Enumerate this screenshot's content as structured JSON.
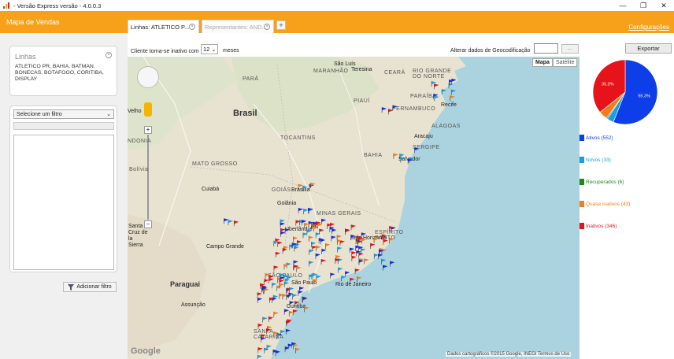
{
  "window": {
    "title": " - Versão Express  versão - 4.0.0.3",
    "minimize": "—",
    "restore": "❐",
    "close": "✕"
  },
  "header": {
    "app_name": "Mapa de Vendas",
    "config_link": "Configurações",
    "tabs": [
      {
        "label": "Linhas: ATLETICO P...",
        "active": true
      },
      {
        "label": "Representantes: AND...",
        "active": false
      }
    ],
    "add_tab": "+"
  },
  "left": {
    "lines_title": "Linhas",
    "lines_text": "ATLETICO PR, BAHIA, BATMAN, BONECAS, BOTAFOGO, CORITIBA, DISPLAY",
    "filter_select": "Selecione um filtro",
    "add_filter": "Adicionar filtro"
  },
  "toolbar": {
    "inactive_label": "Cliente torna-se inativo com",
    "months_value": "12",
    "months_label": "meses",
    "geo_label": "Alterar dados de Geocodificação",
    "geo_button": "...",
    "export": "Exportar"
  },
  "map": {
    "type_map": "Mapa",
    "type_satellite": "Satélite",
    "attribution": "Dados cartográficos ©2015 Google, INEGI    Termos de Uso",
    "google": "Google",
    "places": [
      {
        "text": "Brasil"
      },
      {
        "text": "PARÁ"
      },
      {
        "text": "MARANHÃO"
      },
      {
        "text": "CEARÁ"
      },
      {
        "text": "RIO GRANDE DO NORTE"
      },
      {
        "text": "PARAÍBA"
      },
      {
        "text": "PIAUÍ"
      },
      {
        "text": "PERNAMBUCO"
      },
      {
        "text": "ALAGOAS"
      },
      {
        "text": "SERGIPE"
      },
      {
        "text": "TOCANTINS"
      },
      {
        "text": "BAHIA"
      },
      {
        "text": "MATO GROSSO"
      },
      {
        "text": "GOIÁS"
      },
      {
        "text": "MINAS GERAIS"
      },
      {
        "text": "ESPÍRITO SANTO"
      },
      {
        "text": "Campo Grande"
      },
      {
        "text": "Paraguai"
      },
      {
        "text": "Assunção"
      },
      {
        "text": "Rio de Janeiro"
      },
      {
        "text": "Curitiba"
      },
      {
        "text": "SANTA CATARINA"
      },
      {
        "text": "Cuiabá"
      },
      {
        "text": "Brasília"
      },
      {
        "text": "Goiânia"
      },
      {
        "text": "Uberlândia"
      },
      {
        "text": "Belo Horizonte"
      },
      {
        "text": "Salvador"
      },
      {
        "text": "Aracaju"
      },
      {
        "text": "Recife"
      },
      {
        "text": "Teresina"
      },
      {
        "text": "São Luís"
      },
      {
        "text": "Santa Cruz de la Sierra"
      },
      {
        "text": "Bolívia"
      },
      {
        "text": "NDONIA"
      },
      {
        "text": "Velho"
      },
      {
        "text": "SÃO PAULO"
      },
      {
        "text": "São Paulo"
      }
    ]
  },
  "chart_data": {
    "type": "pie",
    "values": [
      55.3,
      3.3,
      0.6,
      4.3,
      35.3
    ],
    "labels": [
      "55.3%",
      "",
      "",
      "",
      "35.3%"
    ],
    "colors": [
      "#0d3ee8",
      "#1a9de6",
      "#1b8a1b",
      "#f07e1e",
      "#e6141a"
    ]
  },
  "legend": [
    {
      "label": "Ativos (552)",
      "color": "#0d3ee8"
    },
    {
      "label": "Novos (33)",
      "color": "#1a9de6"
    },
    {
      "label": "Recuperados (6)",
      "color": "#1b8a1b"
    },
    {
      "label": "Quase inativos (43)",
      "color": "#f07e1e"
    },
    {
      "label": "Inativos (346)",
      "color": "#e6141a"
    }
  ]
}
